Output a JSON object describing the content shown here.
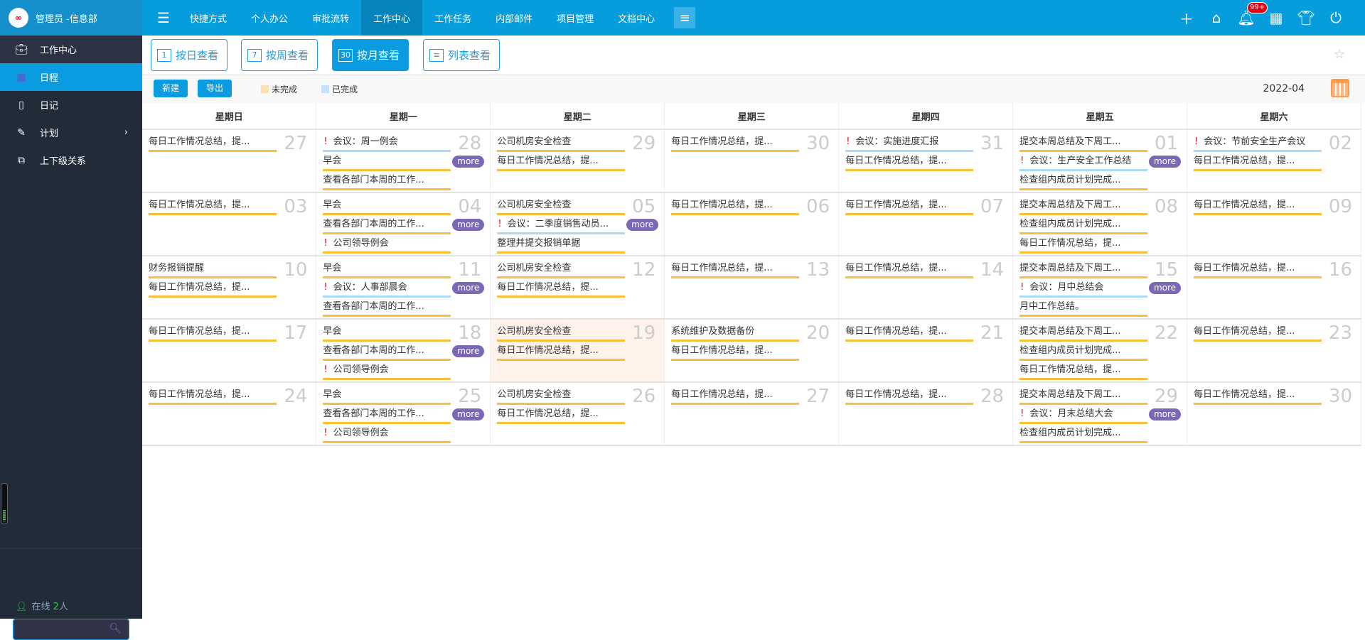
{
  "app": {
    "logo_text": "∞",
    "user": "管理员 -信息部",
    "notification_count": "99+"
  },
  "nav": {
    "items": [
      {
        "label": "快捷方式"
      },
      {
        "label": "个人办公"
      },
      {
        "label": "审批流转"
      },
      {
        "label": "工作中心",
        "active": true
      },
      {
        "label": "工作任务"
      },
      {
        "label": "内部邮件"
      },
      {
        "label": "项目管理"
      },
      {
        "label": "文档中心"
      }
    ]
  },
  "sidebar": {
    "section": "工作中心",
    "items": [
      {
        "label": "日程",
        "icon": "calendar-icon",
        "active": true
      },
      {
        "label": "日记",
        "icon": "book-icon"
      },
      {
        "label": "计划",
        "icon": "edit-icon",
        "has_children": true
      },
      {
        "label": "上下级关系",
        "icon": "hierarchy-icon"
      }
    ],
    "online_label": "在线",
    "online_count": "2",
    "online_unit": "人",
    "search_placeholder": ""
  },
  "toolbar": {
    "views": [
      {
        "label": "按日查看",
        "icon_num": "1"
      },
      {
        "label": "按周查看",
        "icon_num": "7"
      },
      {
        "label": "按月查看",
        "icon_num": "30",
        "active": true
      },
      {
        "label": "列表查看",
        "icon_num": "≡"
      }
    ]
  },
  "actions": {
    "new_label": "新建",
    "export_label": "导出",
    "legend": [
      {
        "label": "未完成",
        "color": "#fde0b0"
      },
      {
        "label": "已完成",
        "color": "#c7e3fb"
      }
    ],
    "month": "2022-04"
  },
  "colors": {
    "accent": "#0a9be0",
    "pending": "#fbbd3b",
    "done": "#a9dbf8",
    "more": "#7b68b5",
    "today": "#fff2ea"
  },
  "calendar": {
    "weekdays": [
      "星期日",
      "星期一",
      "星期二",
      "星期三",
      "星期四",
      "星期五",
      "星期六"
    ],
    "more_label": "more",
    "weeks": [
      [
        {
          "day": "27",
          "events": [
            {
              "text": "每日工作情况总结，提..."
            }
          ]
        },
        {
          "day": "28",
          "more": true,
          "events": [
            {
              "text": "会议：周一例会",
              "important": true,
              "status": "done"
            },
            {
              "text": "早会"
            },
            {
              "text": "查看各部门本周的工作..."
            }
          ]
        },
        {
          "day": "29",
          "events": [
            {
              "text": "公司机房安全检查"
            },
            {
              "text": "每日工作情况总结，提..."
            }
          ]
        },
        {
          "day": "30",
          "events": [
            {
              "text": "每日工作情况总结，提..."
            }
          ]
        },
        {
          "day": "31",
          "events": [
            {
              "text": "会议：实施进度汇报",
              "important": true,
              "status": "done"
            },
            {
              "text": "每日工作情况总结，提..."
            }
          ]
        },
        {
          "day": "01",
          "more": true,
          "events": [
            {
              "text": "提交本周总结及下周工..."
            },
            {
              "text": "会议：生产安全工作总结",
              "important": true,
              "status": "done"
            },
            {
              "text": "检查组内成员计划完成..."
            }
          ]
        },
        {
          "day": "02",
          "events": [
            {
              "text": "会议：节前安全生产会议",
              "important": true,
              "status": "done"
            },
            {
              "text": "每日工作情况总结，提..."
            }
          ]
        }
      ],
      [
        {
          "day": "03",
          "events": [
            {
              "text": "每日工作情况总结，提..."
            }
          ]
        },
        {
          "day": "04",
          "more": true,
          "events": [
            {
              "text": "早会"
            },
            {
              "text": "查看各部门本周的工作..."
            },
            {
              "text": "公司领导例会",
              "important": true
            }
          ]
        },
        {
          "day": "05",
          "more": true,
          "events": [
            {
              "text": "公司机房安全检查"
            },
            {
              "text": "会议：二季度销售动员...",
              "important": true,
              "status": "done"
            },
            {
              "text": "整理并提交报销单据"
            }
          ]
        },
        {
          "day": "06",
          "events": [
            {
              "text": "每日工作情况总结，提..."
            }
          ]
        },
        {
          "day": "07",
          "events": [
            {
              "text": "每日工作情况总结，提..."
            }
          ]
        },
        {
          "day": "08",
          "events": [
            {
              "text": "提交本周总结及下周工..."
            },
            {
              "text": "检查组内成员计划完成..."
            },
            {
              "text": "每日工作情况总结，提..."
            }
          ]
        },
        {
          "day": "09",
          "events": [
            {
              "text": "每日工作情况总结，提..."
            }
          ]
        }
      ],
      [
        {
          "day": "10",
          "events": [
            {
              "text": "财务报销提醒"
            },
            {
              "text": "每日工作情况总结，提..."
            }
          ]
        },
        {
          "day": "11",
          "more": true,
          "events": [
            {
              "text": "早会"
            },
            {
              "text": "会议：人事部晨会",
              "important": true,
              "status": "done"
            },
            {
              "text": "查看各部门本周的工作..."
            }
          ]
        },
        {
          "day": "12",
          "events": [
            {
              "text": "公司机房安全检查"
            },
            {
              "text": "每日工作情况总结，提..."
            }
          ]
        },
        {
          "day": "13",
          "events": [
            {
              "text": "每日工作情况总结，提..."
            }
          ]
        },
        {
          "day": "14",
          "events": [
            {
              "text": "每日工作情况总结，提..."
            }
          ]
        },
        {
          "day": "15",
          "more": true,
          "events": [
            {
              "text": "提交本周总结及下周工..."
            },
            {
              "text": "会议：月中总结会",
              "important": true,
              "status": "done"
            },
            {
              "text": "月中工作总结。"
            }
          ]
        },
        {
          "day": "16",
          "events": [
            {
              "text": "每日工作情况总结，提..."
            }
          ]
        }
      ],
      [
        {
          "day": "17",
          "events": [
            {
              "text": "每日工作情况总结，提..."
            }
          ]
        },
        {
          "day": "18",
          "more": true,
          "events": [
            {
              "text": "早会"
            },
            {
              "text": "查看各部门本周的工作..."
            },
            {
              "text": "公司领导例会",
              "important": true
            }
          ]
        },
        {
          "day": "19",
          "today": true,
          "events": [
            {
              "text": "公司机房安全检查"
            },
            {
              "text": "每日工作情况总结，提..."
            }
          ]
        },
        {
          "day": "20",
          "events": [
            {
              "text": "系统维护及数据备份"
            },
            {
              "text": "每日工作情况总结，提..."
            }
          ]
        },
        {
          "day": "21",
          "events": [
            {
              "text": "每日工作情况总结，提..."
            }
          ]
        },
        {
          "day": "22",
          "events": [
            {
              "text": "提交本周总结及下周工..."
            },
            {
              "text": "检查组内成员计划完成..."
            },
            {
              "text": "每日工作情况总结，提..."
            }
          ]
        },
        {
          "day": "23",
          "events": [
            {
              "text": "每日工作情况总结，提..."
            }
          ]
        }
      ],
      [
        {
          "day": "24",
          "events": [
            {
              "text": "每日工作情况总结，提..."
            }
          ]
        },
        {
          "day": "25",
          "more": true,
          "events": [
            {
              "text": "早会"
            },
            {
              "text": "查看各部门本周的工作..."
            },
            {
              "text": "公司领导例会",
              "important": true
            }
          ]
        },
        {
          "day": "26",
          "events": [
            {
              "text": "公司机房安全检查"
            },
            {
              "text": "每日工作情况总结，提..."
            }
          ]
        },
        {
          "day": "27",
          "events": [
            {
              "text": "每日工作情况总结，提..."
            }
          ]
        },
        {
          "day": "28",
          "events": [
            {
              "text": "每日工作情况总结，提..."
            }
          ]
        },
        {
          "day": "29",
          "more": true,
          "events": [
            {
              "text": "提交本周总结及下周工..."
            },
            {
              "text": "会议：月末总结大会",
              "important": true
            },
            {
              "text": "检查组内成员计划完成..."
            }
          ]
        },
        {
          "day": "30",
          "events": [
            {
              "text": "每日工作情况总结，提..."
            }
          ]
        }
      ]
    ]
  }
}
